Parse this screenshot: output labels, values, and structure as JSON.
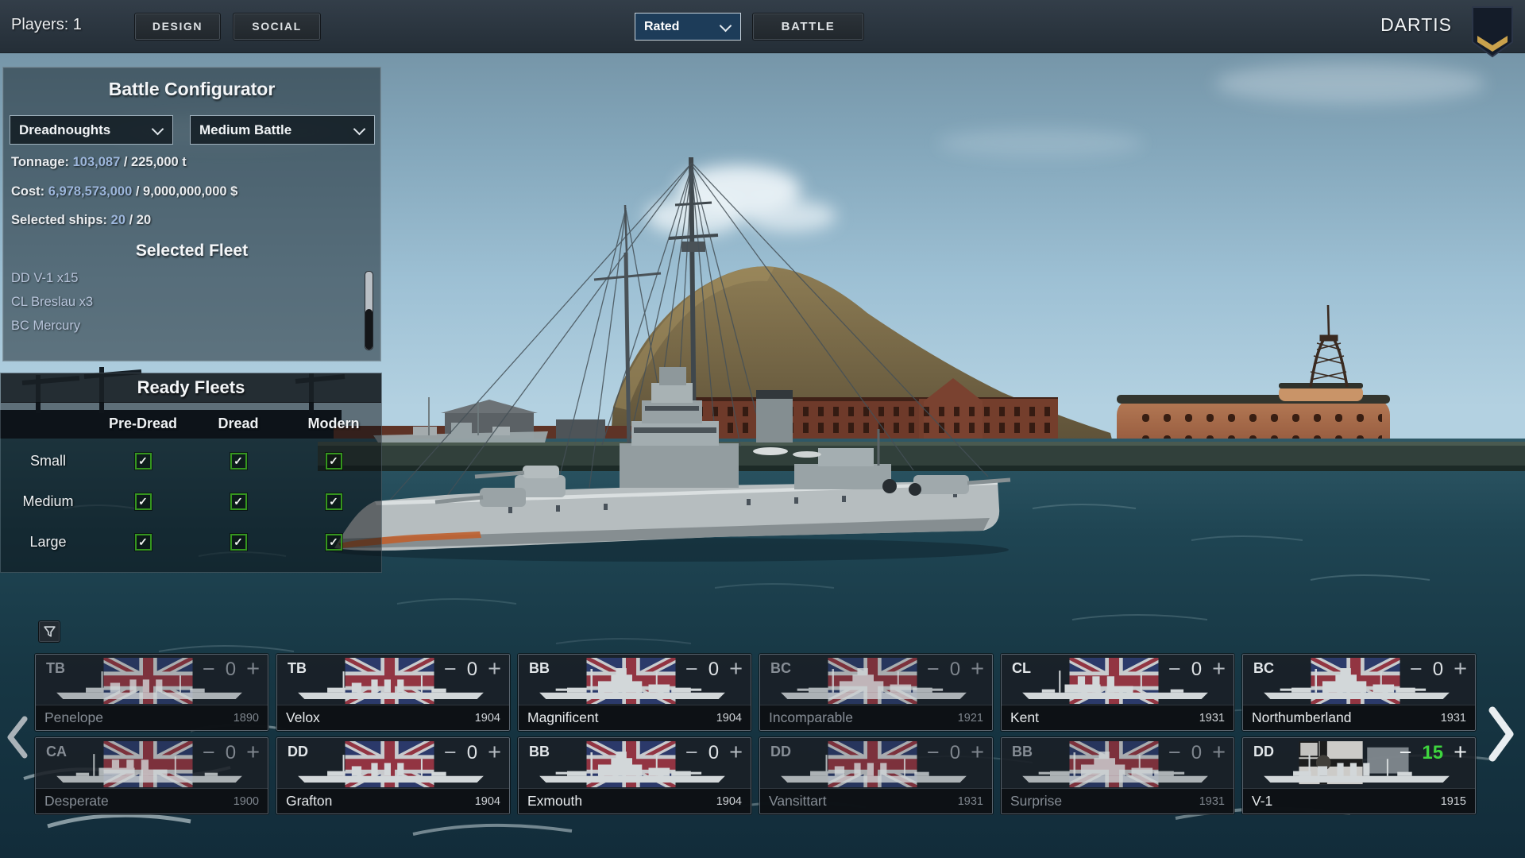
{
  "topbar": {
    "players_label": "Players: 1",
    "design_button": "DESIGN",
    "social_button": "SOCIAL",
    "match_type_value": "Rated",
    "battle_button": "BATTLE",
    "username": "DARTIS"
  },
  "battle_configurator": {
    "title": "Battle Configurator",
    "era_value": "Dreadnoughts",
    "battle_size_value": "Medium Battle",
    "stats": [
      {
        "label": "Tonnage:",
        "value": "103,087",
        "suffix": "/ 225,000 t"
      },
      {
        "label": "Cost:",
        "value": "6,978,573,000",
        "suffix": "/ 9,000,000,000 $"
      },
      {
        "label": "Selected ships:",
        "value": "20",
        "suffix": "/ 20"
      }
    ],
    "fleet_title": "Selected Fleet",
    "fleet_items": [
      "DD V-1 x15",
      "CL Breslau x3",
      "BC Mercury"
    ]
  },
  "ready_fleets": {
    "title": "Ready Fleets",
    "columns": [
      "Pre-Dread",
      "Dread",
      "Modern"
    ],
    "rows": [
      {
        "label": "Small",
        "checks": [
          true,
          true,
          true
        ]
      },
      {
        "label": "Medium",
        "checks": [
          true,
          true,
          true
        ]
      },
      {
        "label": "Large",
        "checks": [
          true,
          true,
          true
        ]
      }
    ]
  },
  "ship_list": {
    "rows": [
      [
        {
          "type": "TB",
          "name": "Penelope",
          "year": "1890",
          "count": "0",
          "flag": "uk",
          "dim": true,
          "size": "small"
        },
        {
          "type": "TB",
          "name": "Velox",
          "year": "1904",
          "count": "0",
          "flag": "uk",
          "dim": false,
          "size": "small"
        },
        {
          "type": "BB",
          "name": "Magnificent",
          "year": "1904",
          "count": "0",
          "flag": "uk",
          "dim": false,
          "size": "large"
        },
        {
          "type": "BC",
          "name": "Incomparable",
          "year": "1921",
          "count": "0",
          "flag": "uk",
          "dim": true,
          "size": "large"
        },
        {
          "type": "CL",
          "name": "Kent",
          "year": "1931",
          "count": "0",
          "flag": "uk",
          "dim": false,
          "size": "medium"
        },
        {
          "type": "BC",
          "name": "Northumberland",
          "year": "1931",
          "count": "0",
          "flag": "uk",
          "dim": false,
          "size": "large"
        }
      ],
      [
        {
          "type": "CA",
          "name": "Desperate",
          "year": "1900",
          "count": "0",
          "flag": "uk",
          "dim": true,
          "size": "medium"
        },
        {
          "type": "DD",
          "name": "Grafton",
          "year": "1904",
          "count": "0",
          "flag": "uk",
          "dim": false,
          "size": "small"
        },
        {
          "type": "BB",
          "name": "Exmouth",
          "year": "1904",
          "count": "0",
          "flag": "uk",
          "dim": false,
          "size": "large"
        },
        {
          "type": "DD",
          "name": "Vansittart",
          "year": "1931",
          "count": "0",
          "flag": "uk",
          "dim": true,
          "size": "small"
        },
        {
          "type": "BB",
          "name": "Surprise",
          "year": "1931",
          "count": "0",
          "flag": "uk",
          "dim": true,
          "size": "large"
        },
        {
          "type": "DD",
          "name": "V-1",
          "year": "1915",
          "count": "15",
          "flag": "de",
          "dim": false,
          "size": "small"
        }
      ]
    ]
  },
  "icons": {
    "filter": "funnel-icon",
    "prev": "chevron-left-icon",
    "next": "chevron-right-icon",
    "rank": "rank-badge",
    "checkmark": "✓"
  },
  "colors": {
    "stat_value_blue": "#9db7dc",
    "count_active_green": "#3ed43e",
    "checkbox_green": "#35961f"
  }
}
